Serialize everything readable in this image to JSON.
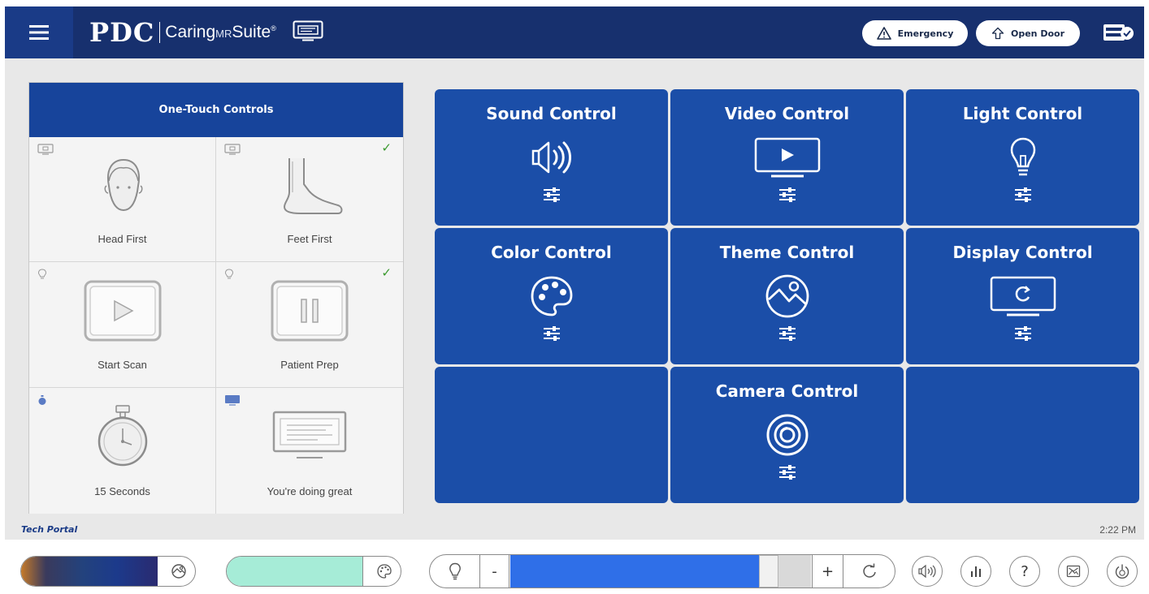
{
  "header": {
    "brand": "PDC",
    "suite_main": "Caring",
    "suite_mr": "MR",
    "suite_end": "Suite",
    "suite_mark": "®",
    "emergency_label": "Emergency",
    "open_door_label": "Open Door"
  },
  "one_touch": {
    "title": "One-Touch Controls",
    "cells": [
      {
        "label": "Head First",
        "checked": false
      },
      {
        "label": "Feet First",
        "checked": true
      },
      {
        "label": "Start Scan",
        "checked": false
      },
      {
        "label": "Patient Prep",
        "checked": true
      },
      {
        "label": "15 Seconds",
        "checked": false
      },
      {
        "label": "You're doing great",
        "checked": false
      }
    ],
    "check_glyph": "✓"
  },
  "controls": [
    {
      "title": "Sound Control",
      "icon": "speaker-icon"
    },
    {
      "title": "Video Control",
      "icon": "video-play-icon"
    },
    {
      "title": "Light Control",
      "icon": "lightbulb-icon"
    },
    {
      "title": "Color Control",
      "icon": "palette-icon"
    },
    {
      "title": "Theme Control",
      "icon": "image-icon"
    },
    {
      "title": "Display Control",
      "icon": "display-refresh-icon"
    },
    {
      "title": "",
      "icon": ""
    },
    {
      "title": "Camera Control",
      "icon": "camera-icon"
    },
    {
      "title": "",
      "icon": ""
    }
  ],
  "footer": {
    "tech_portal": "Tech Portal",
    "time": "2:22 PM"
  },
  "bottom_bar": {
    "color_swatch": "#a6ecd7",
    "minus_label": "-",
    "plus_label": "+",
    "light_level": 0.86,
    "help_label": "?"
  },
  "colors": {
    "header_bg": "#17306e",
    "tile_bg": "#1b4ea8",
    "otc_header_bg": "#17449b",
    "slider_fill": "#2f6fe8",
    "check_green": "#3a9a2e"
  }
}
